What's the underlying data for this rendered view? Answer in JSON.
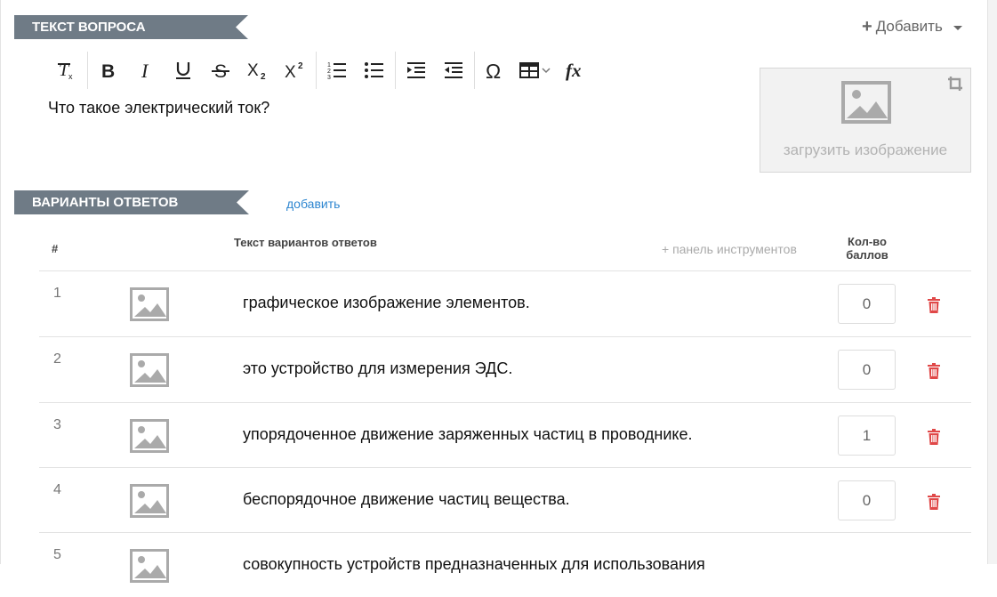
{
  "question_section": {
    "title": "ТЕКСТ ВОПРОСА",
    "add_label": "Добавить",
    "toolbar": [
      {
        "name": "clear-format-icon",
        "glyph": "Tx"
      },
      {
        "name": "bold-icon",
        "glyph": "B"
      },
      {
        "name": "italic-icon",
        "glyph": "I"
      },
      {
        "name": "underline-icon",
        "glyph": "U"
      },
      {
        "name": "strikethrough-icon",
        "glyph": "S"
      },
      {
        "name": "subscript-icon",
        "glyph": "X₂"
      },
      {
        "name": "superscript-icon",
        "glyph": "X²"
      },
      {
        "name": "numbered-list-icon",
        "glyph": "1="
      },
      {
        "name": "bullet-list-icon",
        "glyph": "•="
      },
      {
        "name": "indent-icon",
        "glyph": "→="
      },
      {
        "name": "outdent-icon",
        "glyph": "←="
      },
      {
        "name": "special-char-icon",
        "glyph": "Ω"
      },
      {
        "name": "table-icon",
        "glyph": "⊞"
      },
      {
        "name": "formula-icon",
        "glyph": "fx"
      }
    ],
    "question_text": "Что такое электрический ток?",
    "image_upload_label": "загрузить изображение"
  },
  "answers_section": {
    "title": "ВАРИАНТЫ ОТВЕТОВ",
    "add_link": "добавить",
    "headers": {
      "number": "#",
      "text": "Текст вариантов ответов",
      "toolbar_toggle": "+ панель инструментов",
      "score": "Кол-во баллов"
    },
    "rows": [
      {
        "number": "1",
        "text": "графическое изображение элементов.",
        "score": "0"
      },
      {
        "number": "2",
        "text": "это устройство для измерения ЭДС.",
        "score": "0"
      },
      {
        "number": "3",
        "text": "упорядоченное движение заряженных частиц в проводнике.",
        "score": "1"
      },
      {
        "number": "4",
        "text": "беспорядочное движение частиц вещества.",
        "score": "0"
      },
      {
        "number": "5",
        "text": "совокупность устройств предназначенных для использования",
        "score": ""
      }
    ]
  },
  "colors": {
    "ribbon": "#6f7b86",
    "link": "#2e86d0",
    "delete": "#e04848"
  }
}
